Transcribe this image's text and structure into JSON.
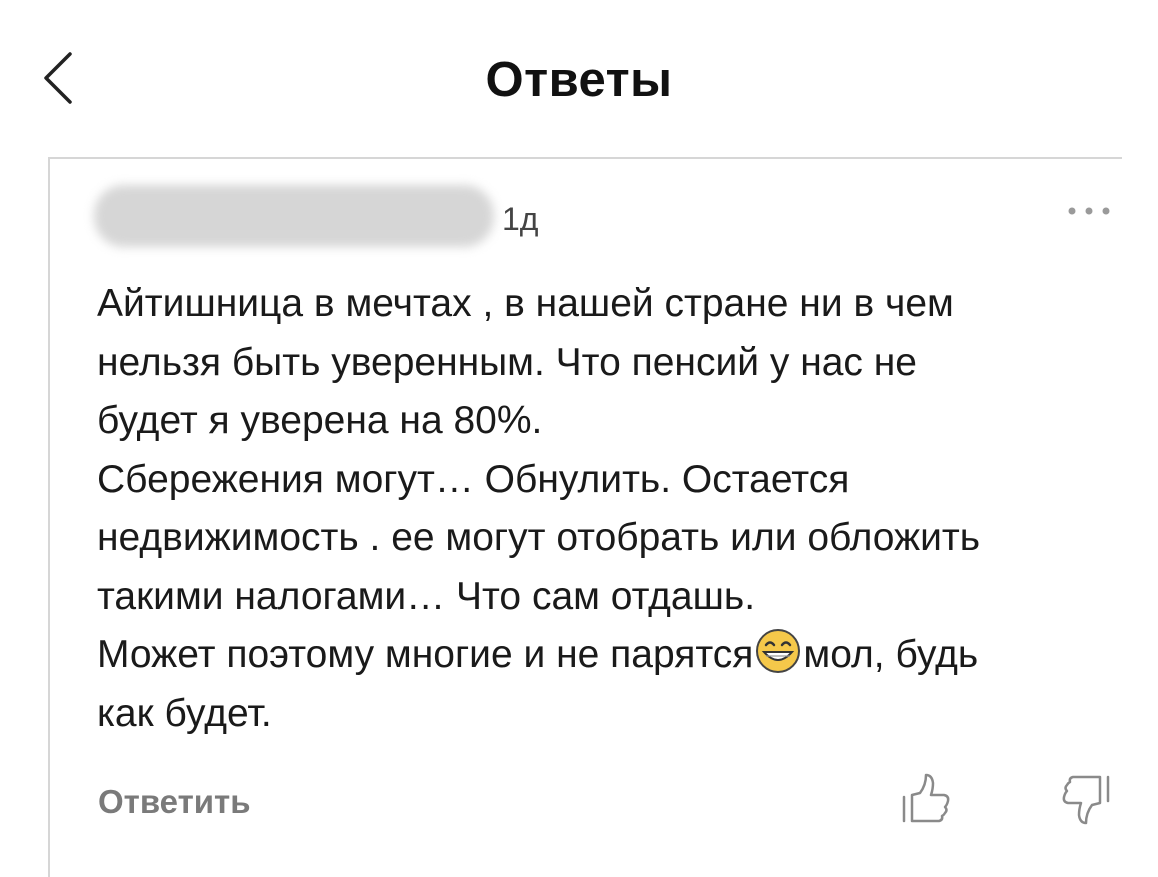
{
  "header": {
    "title": "Ответы",
    "back_icon": "chevron-left-icon"
  },
  "comment": {
    "author": "",
    "time": "1д",
    "more_icon": "more-dots-icon",
    "text_part1": "Айтишница в мечтах , в нашей стране ни в чем\nнельзя быть уверенным. Что пенсий у нас не\nбудет я уверена на 80%.\nСбережения могут… Обнулить. Остается\nнедвижимость . ее могут отобрать или обложить\nтакими налогами… Что сам отдашь.\nМожет поэтому многие и не парятся",
    "emoji_icon": "grinning-face-emoji",
    "text_part2": "мол, будь\nкак будет.",
    "reply_label": "Ответить",
    "like_icon": "thumbs-up-icon",
    "dislike_icon": "thumbs-down-icon"
  },
  "colors": {
    "text": "#1a1a1a",
    "muted": "#7a7a7a",
    "border": "#d6d6d6",
    "emoji": "#f5c84a"
  }
}
